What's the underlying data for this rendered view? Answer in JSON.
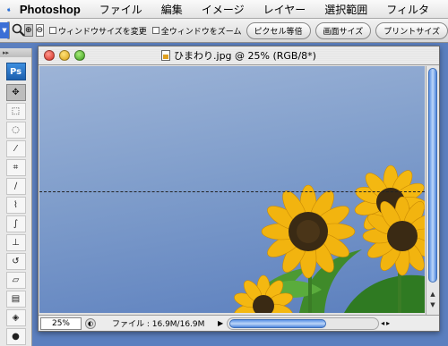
{
  "menubar": {
    "app_name": "Photoshop",
    "items": [
      "ファイル",
      "編集",
      "イメージ",
      "レイヤー",
      "選択範囲",
      "フィルタ"
    ]
  },
  "options_bar": {
    "checkbox_resize_window": "ウィンドウサイズを変更",
    "checkbox_zoom_all": "全ウィンドウをズーム",
    "button_actual_pixels": "ピクセル等倍",
    "button_fit_screen": "画面サイズ",
    "button_print_size": "プリントサイズ"
  },
  "tools": {
    "logo": "Ps"
  },
  "document": {
    "title": "ひまわり.jpg @ 25% (RGB/8*)",
    "zoom": "25%",
    "file_info": "ファイル : 16.9M/16.9M"
  },
  "colors": {
    "sky_top": "#9db4d7",
    "sky_bottom": "#5b7fbe",
    "petal": "#f2b40f",
    "scroll_accent": "#4e86dc"
  }
}
